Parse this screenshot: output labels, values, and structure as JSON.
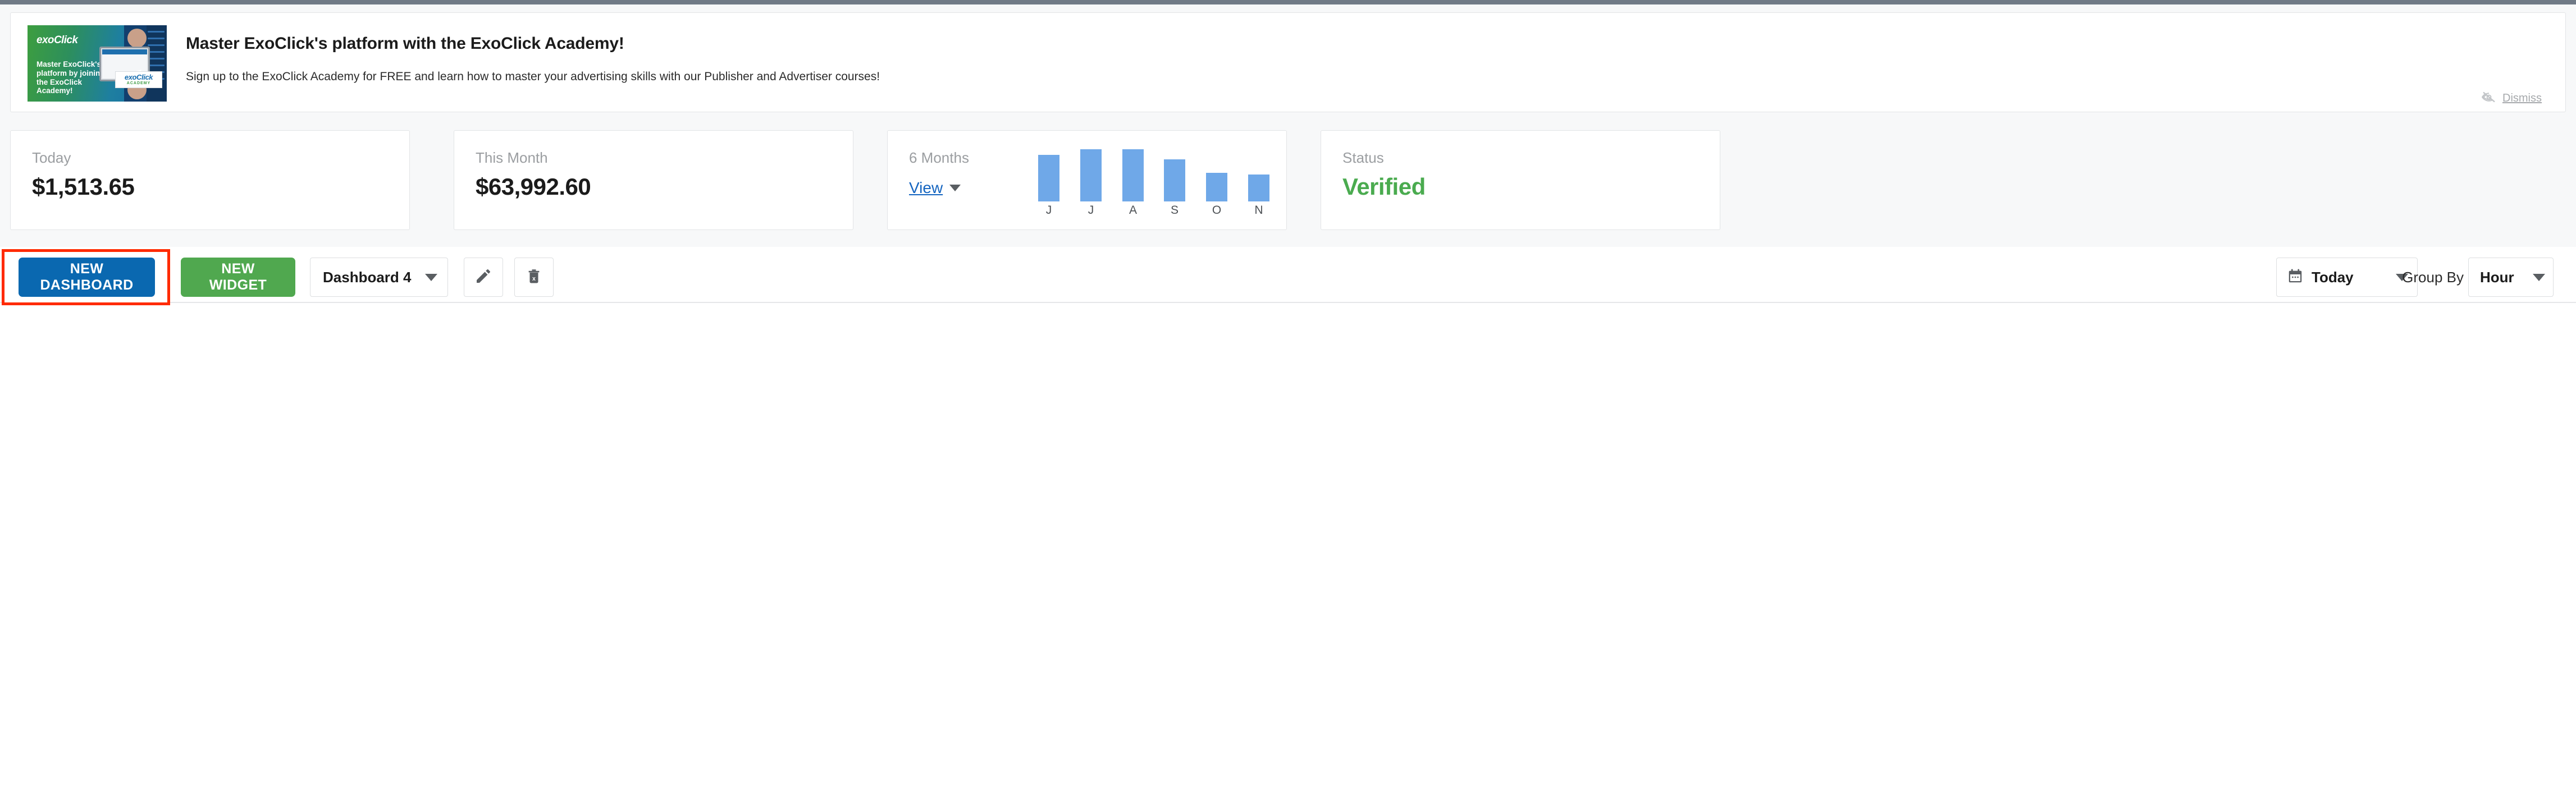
{
  "promo": {
    "title": "Master ExoClick's platform with the ExoClick Academy!",
    "subtitle": "Sign up to the ExoClick Academy for FREE and learn how to master your advertising skills with our Publisher and Advertiser courses!",
    "dismiss_label": "Dismiss",
    "dismiss_icon": "eye-slash-icon",
    "thumbnail": {
      "logo_text": "exoClick",
      "headline": "Master ExoClick's platform by joining the ExoClick Academy!",
      "badge_line1": "exoClick",
      "badge_line2": "ACADEMY",
      "gradient_from": "#3d9e3f",
      "gradient_to": "#1668a8"
    }
  },
  "cards": {
    "today": {
      "label": "Today",
      "value": "$1,513.65"
    },
    "this_month": {
      "label": "This Month",
      "value": "$63,992.60"
    },
    "six_months": {
      "label": "6 Months",
      "view_label": "View",
      "view_caret_icon": "caret-down-icon"
    },
    "status": {
      "label": "Status",
      "value": "Verified",
      "value_color": "#4aab4f"
    }
  },
  "chart_data": {
    "type": "bar",
    "title": "6 Months",
    "categories": [
      "J",
      "J",
      "A",
      "S",
      "O",
      "N"
    ],
    "values": [
      62,
      70,
      70,
      56,
      38,
      36
    ],
    "xlabel": "",
    "ylabel": "",
    "ylim": [
      0,
      78
    ],
    "bar_color": "#6fa8e8",
    "grid": false,
    "legend": false
  },
  "toolbar": {
    "new_dashboard_label": "NEW DASHBOARD",
    "new_dashboard_color": "#0a68b0",
    "new_widget_label": "NEW WIDGET",
    "new_widget_color": "#50a84f",
    "dashboard_select_value": "Dashboard 4",
    "edit_icon": "pencil-icon",
    "delete_icon": "trash-icon",
    "date_select_value": "Today",
    "date_icon": "calendar-icon",
    "group_by_label": "Group By",
    "group_by_value": "Hour",
    "highlight_color": "#ff2a00"
  }
}
